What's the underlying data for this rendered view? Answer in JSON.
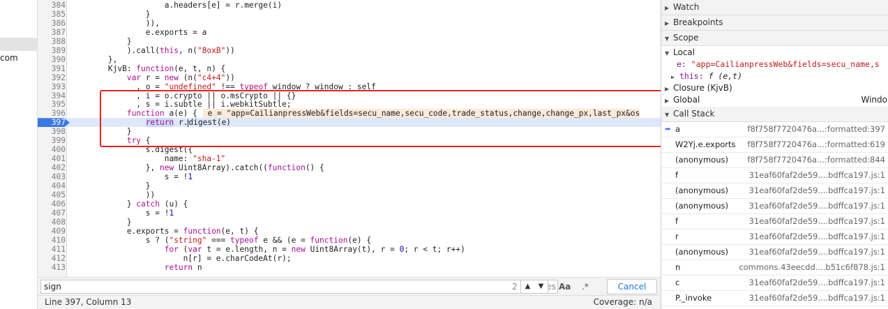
{
  "sidebar": {
    "partial_text": "com"
  },
  "code_lines": [
    {
      "n": "384",
      "html": "                    a.headers[e] = r.merge(i)"
    },
    {
      "n": "385",
      "html": "                }"
    },
    {
      "n": "386",
      "html": "                )),"
    },
    {
      "n": "387",
      "html": "                e.exports = a"
    },
    {
      "n": "388",
      "html": "            }"
    },
    {
      "n": "389",
      "html": "            ).call(<span class='kw'>this</span>, n(<span class='str'>\"8oxB\"</span>))"
    },
    {
      "n": "390",
      "html": "        },"
    },
    {
      "n": "391",
      "html": "        KjvB: <span class='kw'>function</span>(e, t, n) {"
    },
    {
      "n": "392",
      "html": "            <span class='kw'>var</span> r = <span class='kw'>new</span> (n(<span class='str'>\"c4+4\"</span>))"
    },
    {
      "n": "393",
      "html": "              , o = <span class='str'>\"undefined\"</span> !== <span class='kw'>typeof</span> window ? window : self"
    },
    {
      "n": "394",
      "html": "              , i = o.crypto || o.msCrypto || {}"
    },
    {
      "n": "395",
      "html": "              , s = i.subtle || i.webkitSubtle;"
    },
    {
      "n": "396",
      "html": "            <span class='kw'>function</span> a(e) {<span class='inlv'> e = \"app=CailianpressWeb&amp;fields=secu_name,secu_code,trade_status,change,change_px,last_px&amp;os</span>"
    },
    {
      "n": "397",
      "html": "                <span class='retbox'><span class='kw'>return</span></span> r.<span class='caret'></span>digest(e)",
      "exec": true
    },
    {
      "n": "398",
      "html": "            }"
    },
    {
      "n": "399",
      "html": "            <span class='kw'>try</span> {"
    },
    {
      "n": "400",
      "html": "                s.digest({"
    },
    {
      "n": "401",
      "html": "                    name: <span class='str'>\"sha-1\"</span>"
    },
    {
      "n": "402",
      "html": "                }, <span class='kw'>new</span> Uint8Array).catch((<span class='kw'>function</span>() {"
    },
    {
      "n": "403",
      "html": "                    s = !<span class='num'>1</span>"
    },
    {
      "n": "404",
      "html": "                }"
    },
    {
      "n": "405",
      "html": "                ))"
    },
    {
      "n": "406",
      "html": "            } <span class='kw'>catch</span> (u) {"
    },
    {
      "n": "407",
      "html": "                s = !<span class='num'>1</span>"
    },
    {
      "n": "408",
      "html": "            }"
    },
    {
      "n": "409",
      "html": "            e.exports = <span class='kw'>function</span>(e, t) {"
    },
    {
      "n": "410",
      "html": "                s ? (<span class='str'>\"string\"</span> === <span class='kw'>typeof</span> e &amp;&amp; (e = <span class='kw'>function</span>(e) {"
    },
    {
      "n": "411",
      "html": "                    <span class='kw'>for</span> (<span class='kw'>var</span> t = e.length, n = <span class='kw'>new</span> Uint8Array(t), r = <span class='num'>0</span>; r &lt; t; r++)"
    },
    {
      "n": "412",
      "html": "                        n[r] = e.charCodeAt(r);"
    },
    {
      "n": "413",
      "html": "                    <span class='kw'>return</span> n"
    }
  ],
  "search": {
    "value": "sign",
    "matches": "2 matches",
    "match_case": "Aa",
    "regex": ".*",
    "cancel": "Cancel"
  },
  "status": {
    "position": "Line 397, Column 13",
    "coverage": "Coverage: n/a"
  },
  "right": {
    "watch": "Watch",
    "breakpoints": "Breakpoints",
    "scope": "Scope",
    "local": "Local",
    "local_e_key": "e:",
    "local_e_val": "\"app=CailianpressWeb&fields=secu_name,s",
    "this_key": "this:",
    "this_val": "f (e,t)",
    "closure": "Closure (KjvB)",
    "global": "Global",
    "global_val": "Windo",
    "call_stack": "Call Stack",
    "frames": [
      {
        "fn": "a",
        "loc": "f8f758f7720476a...:formatted:397",
        "current": true
      },
      {
        "fn": "W2Yj.e.exports",
        "loc": "f8f758f7720476a...:formatted:619"
      },
      {
        "fn": "(anonymous)",
        "loc": "f8f758f7720476a...:formatted:844"
      },
      {
        "fn": "f",
        "loc": "31eaf60faf2de59....bdffca197.js:1"
      },
      {
        "fn": "(anonymous)",
        "loc": "31eaf60faf2de59....bdffca197.js:1"
      },
      {
        "fn": "(anonymous)",
        "loc": "31eaf60faf2de59....bdffca197.js:1"
      },
      {
        "fn": "f",
        "loc": "31eaf60faf2de59....bdffca197.js:1"
      },
      {
        "fn": "r",
        "loc": "31eaf60faf2de59....bdffca197.js:1"
      },
      {
        "fn": "(anonymous)",
        "loc": "31eaf60faf2de59....bdffca197.js:1"
      },
      {
        "fn": "n",
        "loc": "commons.43eecdd....b51c6f878.js:1"
      },
      {
        "fn": "c",
        "loc": "31eaf60faf2de59....bdffca197.js:1"
      },
      {
        "fn": "P._invoke",
        "loc": "31eaf60faf2de59....bdffca197.js:1"
      }
    ]
  }
}
